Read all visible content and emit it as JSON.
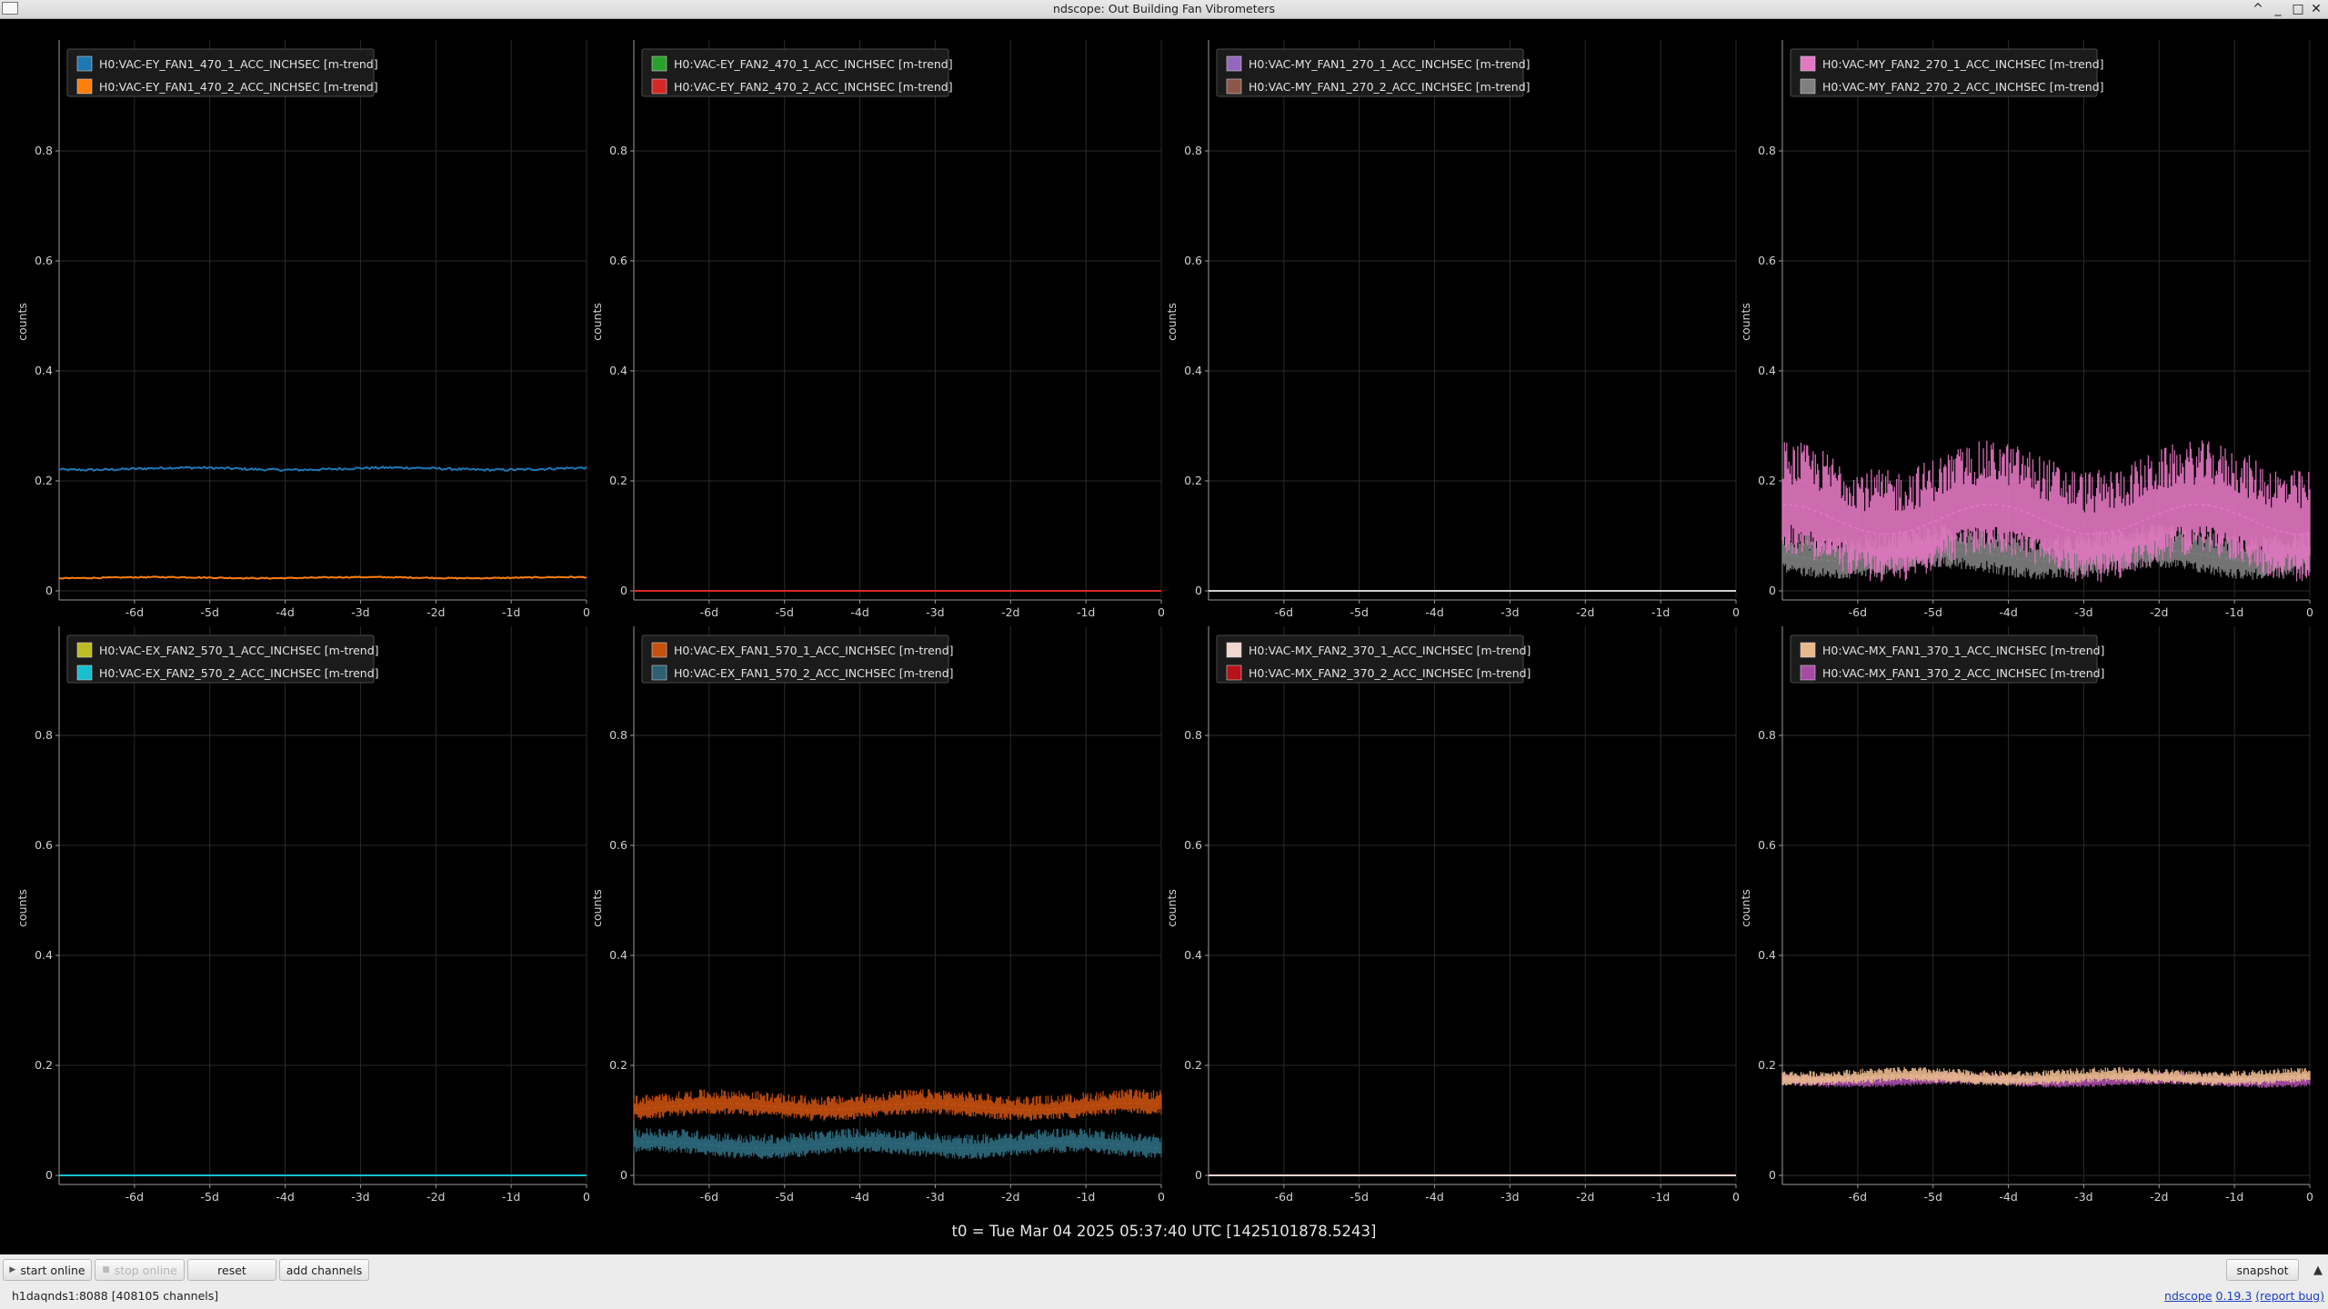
{
  "window": {
    "title": "ndscope: Out Building Fan Vibrometers",
    "buttons": [
      "^",
      "_",
      "□",
      "✕"
    ]
  },
  "plots": [
    {
      "ylabel": "counts",
      "yticks": [
        "0",
        "0.2",
        "0.4",
        "0.6",
        "0.8"
      ],
      "xticks": [
        "-6d",
        "-5d",
        "-4d",
        "-3d",
        "-2d",
        "-1d",
        "0"
      ],
      "legend": [
        {
          "label": "H0:VAC-EY_FAN1_470_1_ACC_INCHSEC [m-trend]",
          "color": "#1f77b4"
        },
        {
          "label": "H0:VAC-EY_FAN1_470_2_ACC_INCHSEC [m-trend]",
          "color": "#ff7f0e"
        }
      ],
      "traces": [
        {
          "color": "#1f77b4",
          "level": 0.222,
          "spread": 0.004,
          "style": "line"
        },
        {
          "color": "#ff7f0e",
          "level": 0.024,
          "spread": 0.002,
          "style": "line"
        }
      ]
    },
    {
      "ylabel": "counts",
      "yticks": [
        "0",
        "0.2",
        "0.4",
        "0.6",
        "0.8"
      ],
      "xticks": [
        "-6d",
        "-5d",
        "-4d",
        "-3d",
        "-2d",
        "-1d",
        "0"
      ],
      "legend": [
        {
          "label": "H0:VAC-EY_FAN2_470_1_ACC_INCHSEC [m-trend]",
          "color": "#2ca02c"
        },
        {
          "label": "H0:VAC-EY_FAN2_470_2_ACC_INCHSEC [m-trend]",
          "color": "#d62728"
        }
      ],
      "traces": [
        {
          "color": "#2ca02c",
          "level": 0.0,
          "spread": 0.0,
          "style": "line"
        },
        {
          "color": "#d62728",
          "level": 0.0,
          "spread": 0.0,
          "style": "line"
        }
      ]
    },
    {
      "ylabel": "counts",
      "yticks": [
        "0",
        "0.2",
        "0.4",
        "0.6",
        "0.8"
      ],
      "xticks": [
        "-6d",
        "-5d",
        "-4d",
        "-3d",
        "-2d",
        "-1d",
        "0"
      ],
      "legend": [
        {
          "label": "H0:VAC-MY_FAN1_270_1_ACC_INCHSEC [m-trend]",
          "color": "#9467bd"
        },
        {
          "label": "H0:VAC-MY_FAN1_270_2_ACC_INCHSEC [m-trend]",
          "color": "#8c564b"
        }
      ],
      "traces": [
        {
          "color": "#9467bd",
          "level": 0.0,
          "spread": 0.0,
          "style": "line"
        },
        {
          "color": "#cfcfcf",
          "level": 0.0,
          "spread": 0.0,
          "style": "line"
        }
      ]
    },
    {
      "ylabel": "counts",
      "yticks": [
        "0",
        "0.2",
        "0.4",
        "0.6",
        "0.8"
      ],
      "xticks": [
        "-6d",
        "-5d",
        "-4d",
        "-3d",
        "-2d",
        "-1d",
        "0"
      ],
      "legend": [
        {
          "label": "H0:VAC-MY_FAN2_270_1_ACC_INCHSEC [m-trend]",
          "color": "#e377c2"
        },
        {
          "label": "H0:VAC-MY_FAN2_270_2_ACC_INCHSEC [m-trend]",
          "color": "#7f7f7f"
        }
      ],
      "traces": [
        {
          "color": "#7f7f7f",
          "level": 0.065,
          "spread": 0.035,
          "style": "band"
        },
        {
          "color": "#e377c2",
          "level": 0.13,
          "spread": 0.09,
          "style": "band"
        }
      ]
    },
    {
      "ylabel": "counts",
      "yticks": [
        "0",
        "0.2",
        "0.4",
        "0.6",
        "0.8"
      ],
      "xticks": [
        "-6d",
        "-5d",
        "-4d",
        "-3d",
        "-2d",
        "-1d",
        "0"
      ],
      "legend": [
        {
          "label": "H0:VAC-EX_FAN2_570_1_ACC_INCHSEC [m-trend]",
          "color": "#bcbd22"
        },
        {
          "label": "H0:VAC-EX_FAN2_570_2_ACC_INCHSEC [m-trend]",
          "color": "#17becf"
        }
      ],
      "traces": [
        {
          "color": "#bcbd22",
          "level": 0.0,
          "spread": 0.0,
          "style": "line"
        },
        {
          "color": "#17becf",
          "level": 0.0,
          "spread": 0.0,
          "style": "line"
        }
      ]
    },
    {
      "ylabel": "counts",
      "yticks": [
        "0",
        "0.2",
        "0.4",
        "0.6",
        "0.8"
      ],
      "xticks": [
        "-6d",
        "-5d",
        "-4d",
        "-3d",
        "-2d",
        "-1d",
        "0"
      ],
      "legend": [
        {
          "label": "H0:VAC-EX_FAN1_570_1_ACC_INCHSEC [m-trend]",
          "color": "#c5500f"
        },
        {
          "label": "H0:VAC-EX_FAN1_570_2_ACC_INCHSEC [m-trend]",
          "color": "#2e5f72"
        }
      ],
      "traces": [
        {
          "color": "#2e6b80",
          "level": 0.055,
          "spread": 0.02,
          "style": "band"
        },
        {
          "color": "#c5500f",
          "level": 0.125,
          "spread": 0.02,
          "style": "band"
        }
      ]
    },
    {
      "ylabel": "counts",
      "yticks": [
        "0",
        "0.2",
        "0.4",
        "0.6",
        "0.8"
      ],
      "xticks": [
        "-6d",
        "-5d",
        "-4d",
        "-3d",
        "-2d",
        "-1d",
        "0"
      ],
      "legend": [
        {
          "label": "H0:VAC-MX_FAN2_370_1_ACC_INCHSEC [m-trend]",
          "color": "#f2d6d0"
        },
        {
          "label": "H0:VAC-MX_FAN2_370_2_ACC_INCHSEC [m-trend]",
          "color": "#b5121b"
        }
      ],
      "traces": [
        {
          "color": "#b5121b",
          "level": 0.0,
          "spread": 0.0,
          "style": "line"
        },
        {
          "color": "#f2d6d0",
          "level": 0.0,
          "spread": 0.0,
          "style": "line"
        }
      ]
    },
    {
      "ylabel": "counts",
      "yticks": [
        "0",
        "0.2",
        "0.4",
        "0.6",
        "0.8"
      ],
      "xticks": [
        "-6d",
        "-5d",
        "-4d",
        "-3d",
        "-2d",
        "-1d",
        "0"
      ],
      "legend": [
        {
          "label": "H0:VAC-MX_FAN1_370_1_ACC_INCHSEC [m-trend]",
          "color": "#e9b98e"
        },
        {
          "label": "H0:VAC-MX_FAN1_370_2_ACC_INCHSEC [m-trend]",
          "color": "#a64ca6"
        }
      ],
      "traces": [
        {
          "color": "#a64ca6",
          "level": 0.172,
          "spread": 0.01,
          "style": "band"
        },
        {
          "color": "#e9b98e",
          "level": 0.178,
          "spread": 0.012,
          "style": "band"
        }
      ]
    }
  ],
  "t0_text": "t0 = Tue Mar 04 2025 05:37:40 UTC [1425101878.5243]",
  "toolbar": {
    "start_online": "start online",
    "stop_online": "stop online",
    "reset": "reset",
    "add_channels": "add channels",
    "snapshot": "snapshot"
  },
  "status": {
    "server": "h1daqnds1:8088 [408105 channels]",
    "app_name": "ndscope",
    "version": "0.19.3",
    "report_bug": "(report bug)"
  }
}
